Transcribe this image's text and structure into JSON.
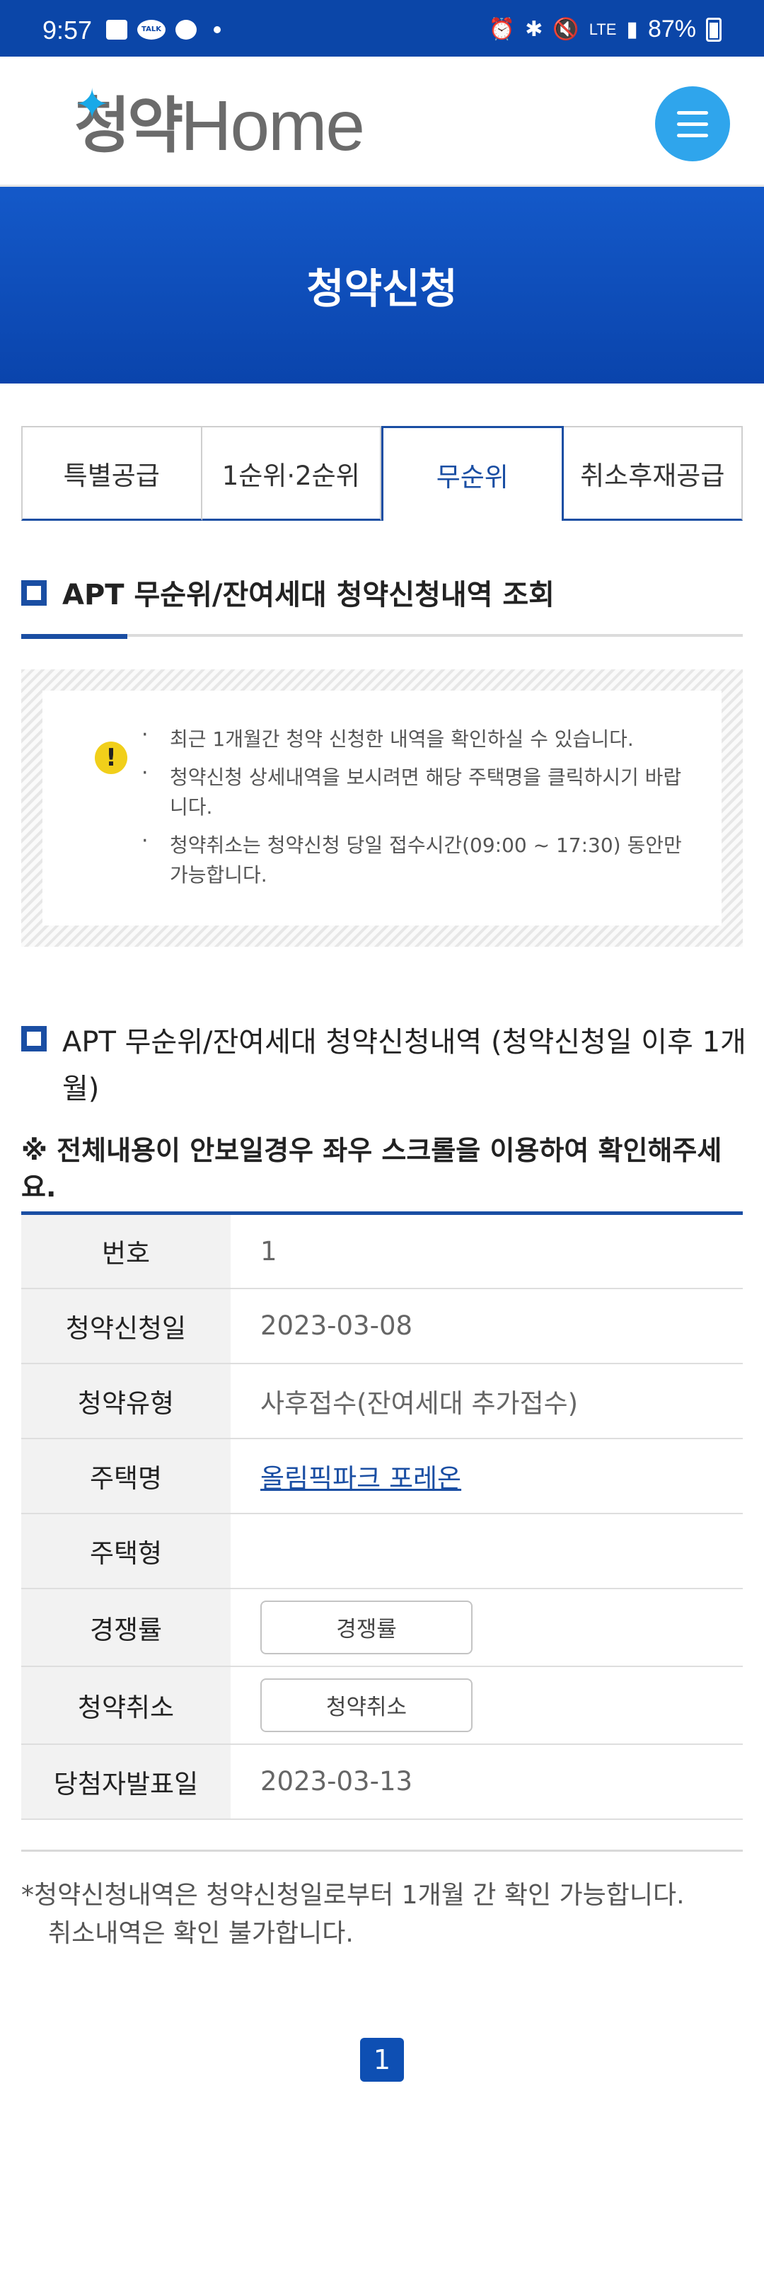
{
  "status_bar": {
    "time": "9:57",
    "talk": "TALK",
    "network": "LTE",
    "battery": "87%"
  },
  "header": {
    "logo_text_ko": "청약",
    "logo_text_en": "Home"
  },
  "banner": {
    "title": "청약신청"
  },
  "tabs": [
    {
      "label": "특별공급",
      "active": false
    },
    {
      "label": "1순위·2순위",
      "active": false
    },
    {
      "label": "무순위",
      "active": true
    },
    {
      "label": "취소후재공급",
      "active": false
    }
  ],
  "section1": {
    "title": "APT 무순위/잔여세대 청약신청내역 조회"
  },
  "notice": {
    "items": [
      "최근 1개월간 청약 신청한 내역을 확인하실 수 있습니다.",
      "청약신청 상세내역을 보시려면 해당 주택명을 클릭하시기 바랍니다.",
      "청약취소는 청약신청 당일 접수시간(09:00 ~ 17:30) 동안만 가능합니다."
    ]
  },
  "section2": {
    "title": "APT 무순위/잔여세대 청약신청내역 (청약신청일 이후 1개월)"
  },
  "scroll_note": "※ 전체내용이 안보일경우 좌우 스크롤을 이용하여 확인해주세요.",
  "table": {
    "no_label": "번호",
    "no_value": "1",
    "date_label": "청약신청일",
    "date_value": "2023-03-08",
    "type_label": "청약유형",
    "type_value": "사후접수(잔여세대 추가접수)",
    "house_label": "주택명",
    "house_value": "올림픽파크 포레온",
    "housetype_label": "주택형",
    "housetype_value": "",
    "competition_label": "경쟁률",
    "competition_button": "경쟁률",
    "cancel_label": "청약취소",
    "cancel_button": "청약취소",
    "announce_label": "당첨자발표일",
    "announce_value": "2023-03-13"
  },
  "footnote": {
    "line1": "*청약신청내역은 청약신청일로부터 1개월 간 확인 가능합니다.",
    "line2": "취소내역은 확인 불가합니다."
  },
  "pagination": {
    "current": "1"
  },
  "colors": {
    "primary": "#1a4ea3",
    "banner": "#0a44ac",
    "menu": "#2fa5ec",
    "warning": "#f1cf1a"
  }
}
